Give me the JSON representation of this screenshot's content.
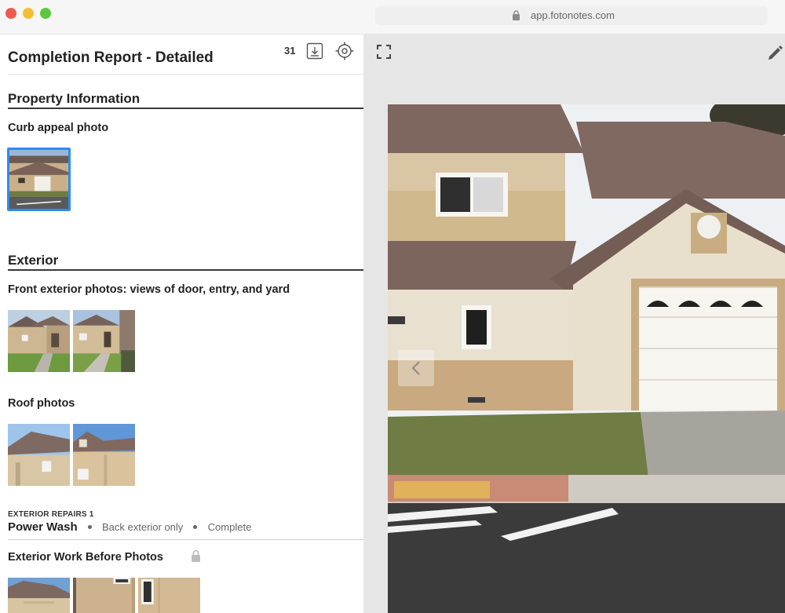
{
  "browser": {
    "url": "app.fotonotes.com"
  },
  "report": {
    "title": "Completion Report - Detailed",
    "photo_count": "31",
    "icons": [
      "download-icon",
      "target-icon",
      "expand-icon",
      "pencil-icon",
      "lock-icon",
      "chevron-left-icon"
    ]
  },
  "sections": {
    "property_info": {
      "heading": "Property Information",
      "curb_label": "Curb appeal photo"
    },
    "exterior": {
      "heading": "Exterior",
      "front_label": "Front exterior photos: views of door, entry, and yard",
      "roof_label": "Roof photos",
      "repairs_kicker": "EXTERIOR REPAIRS 1",
      "repair": {
        "name": "Power Wash",
        "scope": "Back exterior only",
        "status": "Complete"
      },
      "work_before_label": "Exterior Work Before Photos"
    }
  },
  "colors": {
    "selected_border": "#2d8cf0",
    "section_rule": "#3a3a3a",
    "viewer_bg": "#e6e6e6"
  }
}
